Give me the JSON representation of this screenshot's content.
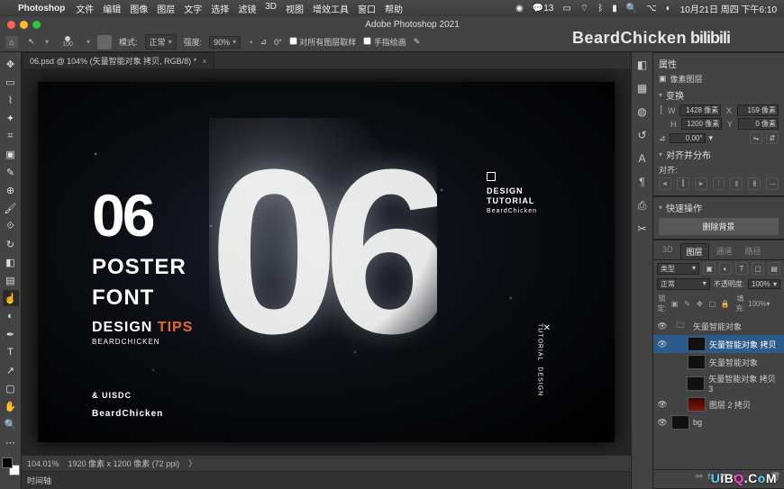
{
  "mac": {
    "app": "Photoshop",
    "menus": [
      "文件",
      "编辑",
      "图像",
      "图层",
      "文字",
      "选择",
      "滤镜",
      "3D",
      "视图",
      "增效工具",
      "窗口",
      "帮助"
    ],
    "notif": "13",
    "clock": "10月21日 周四 下午6:10"
  },
  "window": {
    "title": "Adobe Photoshop 2021"
  },
  "options": {
    "brush_size": "100",
    "mode_label": "模式:",
    "mode_value": "正常",
    "strength_label": "强度:",
    "strength_value": "90%",
    "angle": "0°",
    "sample_all": "对所有图层取样",
    "finger": "手指绘画"
  },
  "brand": {
    "right": "BeardChicken",
    "bili": "bilibili"
  },
  "tab": {
    "label": "06.psd @ 104% (矢量智能对象 拷贝, RGB/8) *"
  },
  "canvas": {
    "num06": "06",
    "poster_l1": "POSTER",
    "poster_l2": "FONT",
    "design": "DESIGN",
    "tips": "TIPS",
    "bc_small": "BEARDCHICKEN",
    "uisdc": "& UISDC",
    "bc_big": "BeardChicken",
    "big": "06",
    "r_l1": "DESIGN",
    "r_l2": "TUTORIAL",
    "r_sm": "BeardChicken",
    "v_l1": "DESIGN",
    "v_l2": "TUTORIAL"
  },
  "status": {
    "zoom": "104.01%",
    "info": "1920 像素 x 1200 像素 (72 ppi)"
  },
  "timeline": {
    "label": "时间轴"
  },
  "props": {
    "title": "属性",
    "kind_icon_label": "像素图层",
    "transform": "变换",
    "W": "1428 像素",
    "X": "159 像素",
    "H": "1200 像素",
    "Y": "0 像素",
    "angle": "0.00°",
    "flip_label": "⇋",
    "align_title": "对齐并分布",
    "align_label": "对齐:"
  },
  "quick": {
    "title": "快速操作",
    "btn": "删除背景"
  },
  "layers_panel": {
    "tabs": [
      "3D",
      "图层",
      "通道",
      "路径"
    ],
    "kind": "类型",
    "blend": "正常",
    "opacity_label": "不透明度:",
    "opacity": "100%",
    "lock": "锁定:",
    "fill_label": "填充:",
    "fill": "100%",
    "layers": [
      {
        "eye": true,
        "folder": true,
        "name": "矢量智能对象",
        "indent": 0
      },
      {
        "eye": true,
        "thumb": "dark",
        "name": "矢量智能对象 拷贝",
        "indent": 1,
        "sel": true
      },
      {
        "eye": false,
        "thumb": "dark",
        "name": "矢量智能对象",
        "indent": 1
      },
      {
        "eye": false,
        "thumb": "dark",
        "name": "矢量智能对象 拷贝 3",
        "indent": 1
      },
      {
        "eye": true,
        "thumb": "red",
        "name": "图层 2 拷贝",
        "indent": 1
      },
      {
        "eye": true,
        "thumb": "dark",
        "name": "bg",
        "indent": 0
      }
    ]
  },
  "watermark": "UiBQ.CoM"
}
